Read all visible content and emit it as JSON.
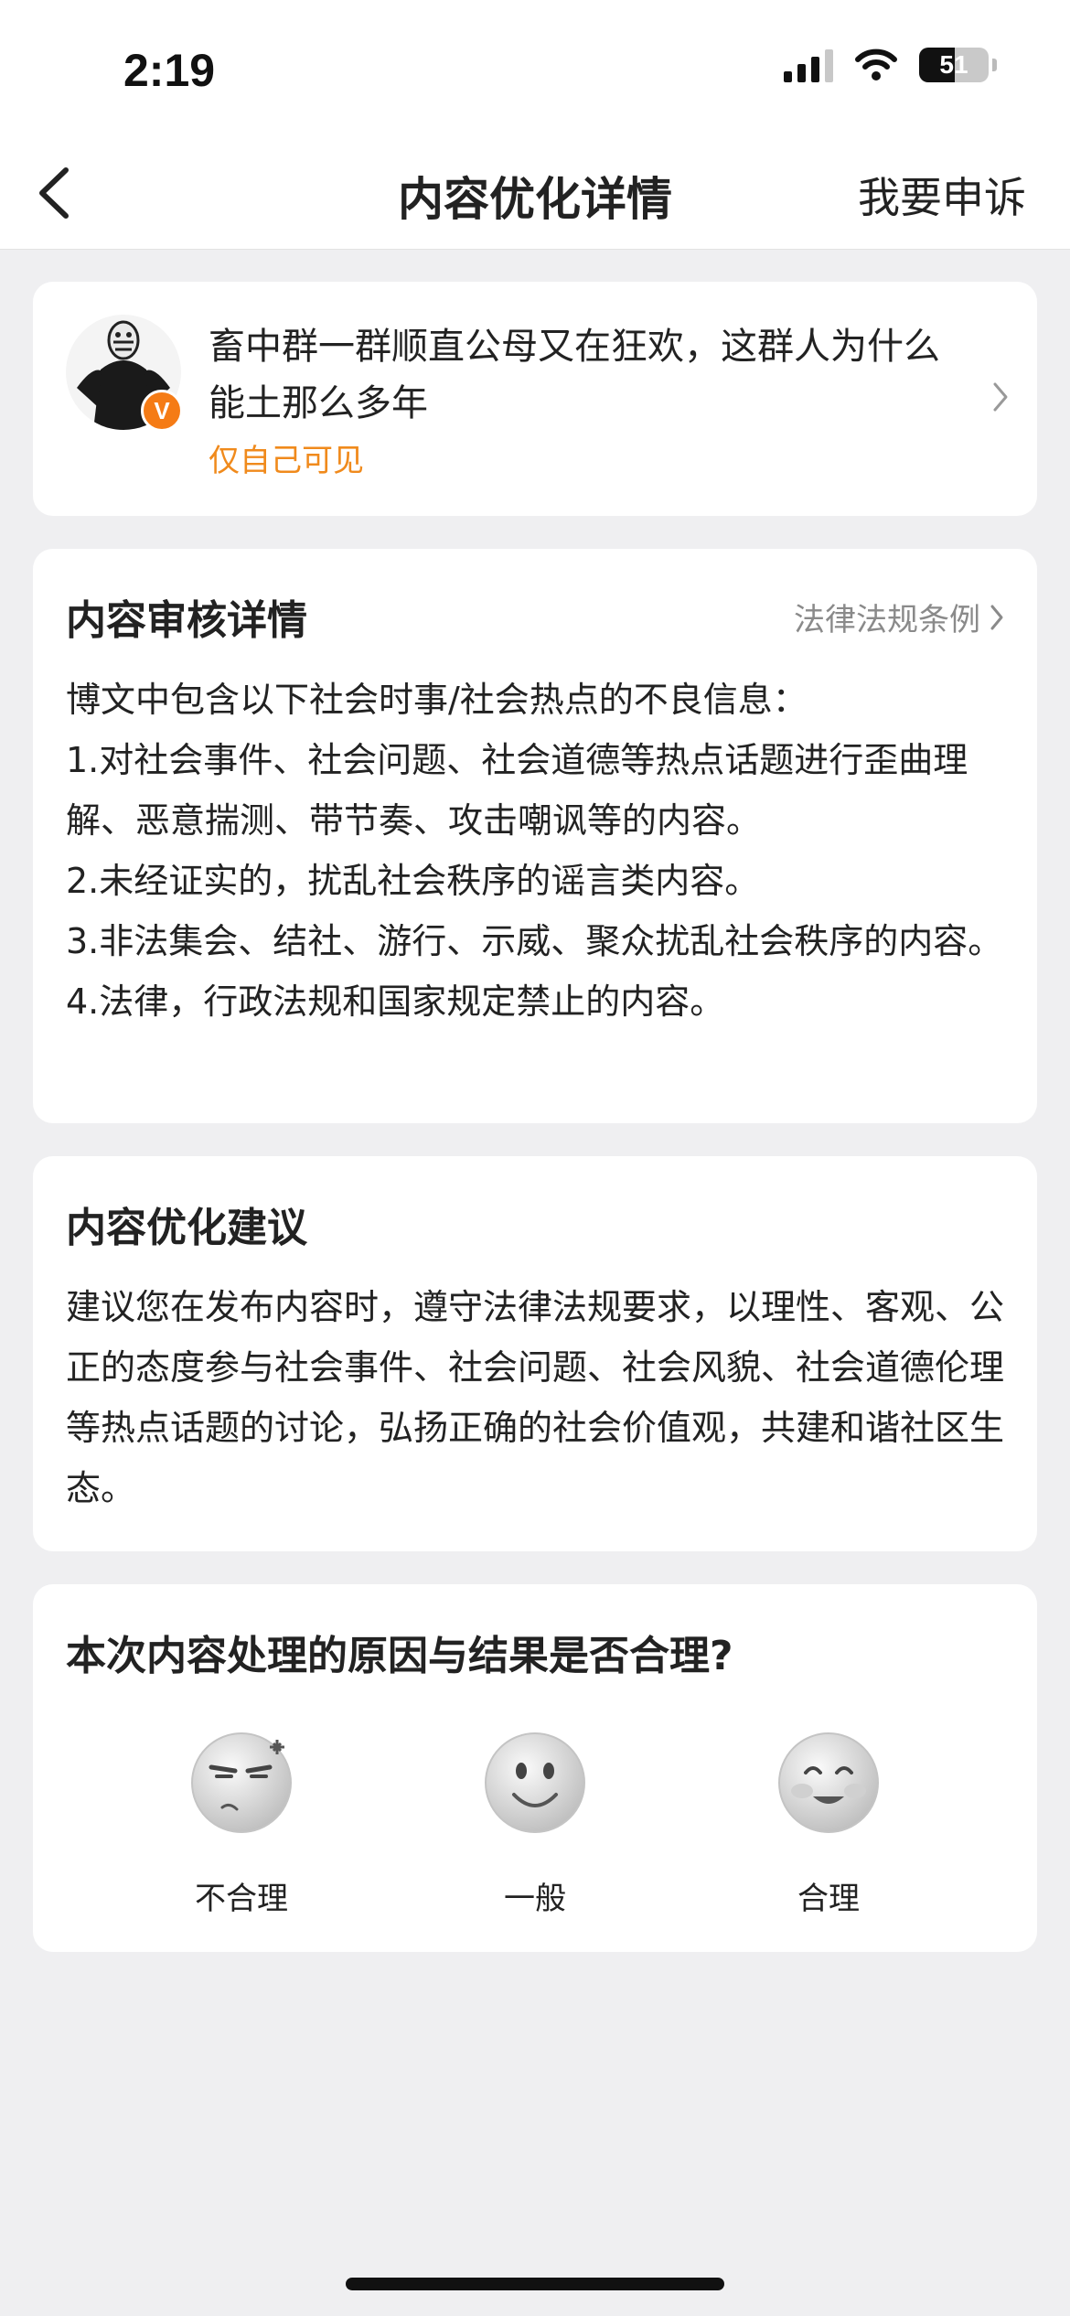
{
  "status_bar": {
    "time": "2:19",
    "battery": "51",
    "battery_level": 0.51
  },
  "nav": {
    "title": "内容优化详情",
    "appeal_label": "我要申诉"
  },
  "post": {
    "text": "畜中群一群顺直公母又在狂欢，这群人为什么能土那么多年",
    "visibility": "仅自己可见",
    "badge": "V"
  },
  "review": {
    "title": "内容审核详情",
    "law_link": "法律法规条例",
    "lines": [
      "博文中包含以下社会时事/社会热点的不良信息：",
      "1.对社会事件、社会问题、社会道德等热点话题进行歪曲理解、恶意揣测、带节奏、攻击嘲讽等的内容。",
      "2.未经证实的，扰乱社会秩序的谣言类内容。",
      "3.非法集会、结社、游行、示威、聚众扰乱社会秩序的内容。",
      "4.法律，行政法规和国家规定禁止的内容。"
    ]
  },
  "suggestion": {
    "title": "内容优化建议",
    "text": "建议您在发布内容时，遵守法律法规要求，以理性、客观、公正的态度参与社会事件、社会问题、社会风貌、社会道德伦理等热点话题的讨论，弘扬正确的社会价值观，共建和谐社区生态。"
  },
  "rating": {
    "question": "本次内容处理的原因与结果是否合理?",
    "options": [
      {
        "label": "不合理",
        "icon": "angry-face-icon"
      },
      {
        "label": "一般",
        "icon": "neutral-face-icon"
      },
      {
        "label": "合理",
        "icon": "happy-face-icon"
      }
    ]
  }
}
